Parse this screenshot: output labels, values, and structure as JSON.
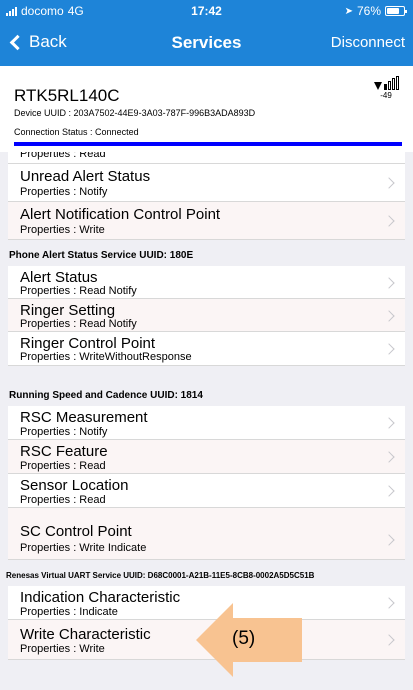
{
  "status_bar": {
    "carrier": "docomo",
    "network": "4G",
    "time": "17:42",
    "battery_percent": "76%",
    "battery_level": 0.76
  },
  "nav": {
    "back_label": "Back",
    "title": "Services",
    "disconnect_label": "Disconnect"
  },
  "device": {
    "name": "RTK5RL140C",
    "rssi": "-49",
    "uuid": "Device UUID : 203A7502-44E9-3A03-787F-996B3ADA893D",
    "connection_status": "Connection Status :  Connected"
  },
  "top_partial_props": "Properties : Read",
  "groups": [
    {
      "header": "",
      "items": [
        {
          "title": "Unread Alert Status",
          "props": "Properties : Notify"
        },
        {
          "title": "Alert Notification Control Point",
          "props": "Properties : Write"
        }
      ]
    },
    {
      "header": "Phone Alert Status Service  UUID: 180E",
      "items": [
        {
          "title": "Alert Status",
          "props": "Properties : Read  Notify"
        },
        {
          "title": "Ringer Setting",
          "props": "Properties : Read  Notify"
        },
        {
          "title": "Ringer Control Point",
          "props": "Properties : WriteWithoutResponse"
        }
      ]
    },
    {
      "header": "Running Speed and Cadence  UUID: 1814",
      "items": [
        {
          "title": "RSC Measurement",
          "props": "Properties : Notify"
        },
        {
          "title": "RSC Feature",
          "props": "Properties : Read"
        },
        {
          "title": "Sensor Location",
          "props": "Properties : Read"
        },
        {
          "title": "SC Control Point",
          "props": "Properties : Write  Indicate"
        }
      ]
    },
    {
      "header": "Renesas Virtual UART Service  UUID: D68C0001-A21B-11E5-8CB8-0002A5D5C51B",
      "items": [
        {
          "title": "Indication Characteristic",
          "props": "Properties : Indicate"
        },
        {
          "title": "Write Characteristic",
          "props": "Properties : Write"
        }
      ]
    }
  ],
  "annotation": {
    "label": "(5)",
    "color": "#f8c391"
  },
  "colors": {
    "accent": "#1e84d8",
    "connection_bar": "#0000ff"
  }
}
